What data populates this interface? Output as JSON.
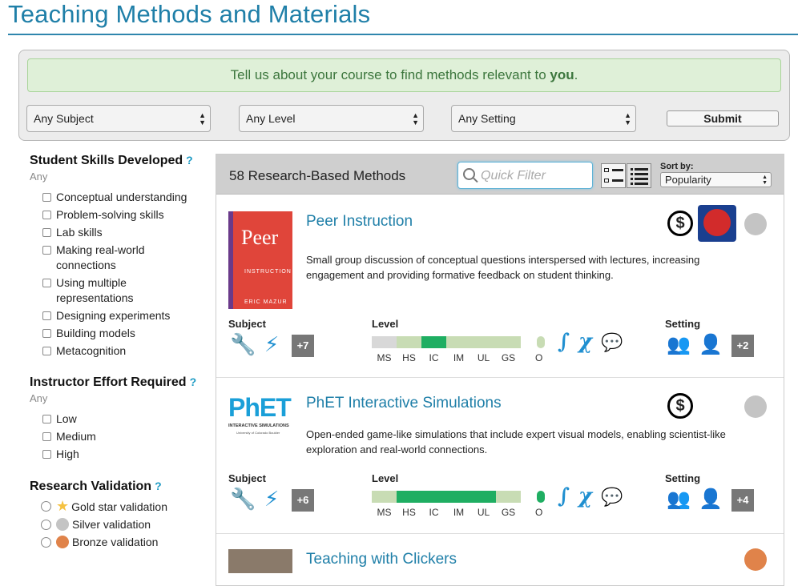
{
  "page": {
    "title": "Teaching Methods and Materials"
  },
  "course": {
    "prompt_text": "Tell us about your course to find methods relevant to",
    "prompt_emph": "you",
    "prompt_end": ".",
    "subject": "Any Subject",
    "level": "Any Level",
    "setting": "Any Setting",
    "submit": "Submit"
  },
  "filters": {
    "skills": {
      "heading": "Student Skills Developed",
      "help": "?",
      "any": "Any",
      "options": [
        "Conceptual understanding",
        "Problem-solving skills",
        "Lab skills",
        "Making real-world connections",
        "Using multiple representations",
        "Designing experiments",
        "Building models",
        "Metacognition"
      ]
    },
    "effort": {
      "heading": "Instructor Effort Required",
      "help": "?",
      "any": "Any",
      "options": [
        "Low",
        "Medium",
        "High"
      ]
    },
    "validation": {
      "heading": "Research Validation",
      "help": "?",
      "options": [
        {
          "label": "Gold star validation",
          "color": "#f5c242"
        },
        {
          "label": "Silver validation",
          "color": "#c4c4c4"
        },
        {
          "label": "Bronze validation",
          "color": "#e0834a"
        }
      ]
    }
  },
  "results": {
    "count_label": "58 Research-Based Methods",
    "quick_filter_placeholder": "Quick Filter",
    "sort_label": "Sort by:",
    "sort_value": "Popularity",
    "level_ticks": [
      "MS",
      "HS",
      "IC",
      "IM",
      "UL",
      "GS"
    ],
    "labels": {
      "subject": "Subject",
      "level": "Level",
      "setting": "Setting",
      "other": "O"
    },
    "methods": [
      {
        "title": "Peer Instruction",
        "description": "Small group discussion of conceptual questions interspersed with lectures, increasing engagement and providing formative feedback on student thinking.",
        "subject_more": "+7",
        "setting_more": "+2",
        "level_range": [
          2,
          2
        ],
        "other_level": false,
        "validation_color": "#c4c4c4",
        "book": {
          "title": "Peer",
          "subtitle": "INSTRUCTION",
          "author": "ERIC MAZUR"
        }
      },
      {
        "title": "PhET Interactive Simulations",
        "description": "Open-ended game-like simulations that include expert visual models, enabling scientist-like exploration and real-world connections.",
        "subject_more": "+6",
        "setting_more": "+4",
        "level_range": [
          1,
          5
        ],
        "other_level": true,
        "validation_color": "#c4c4c4",
        "logo": {
          "main": "PhET",
          "sub": "INTERACTIVE SIMULATIONS",
          "univ": "University of Colorado Boulder"
        }
      },
      {
        "title": "Teaching with Clickers",
        "validation_color": "#e0834a"
      }
    ]
  },
  "colors": {
    "accent": "#1f7fa8",
    "level_fill": "#1fae62",
    "level_track": "#c8dcb4",
    "icon_blue": "#1f8fd0"
  }
}
